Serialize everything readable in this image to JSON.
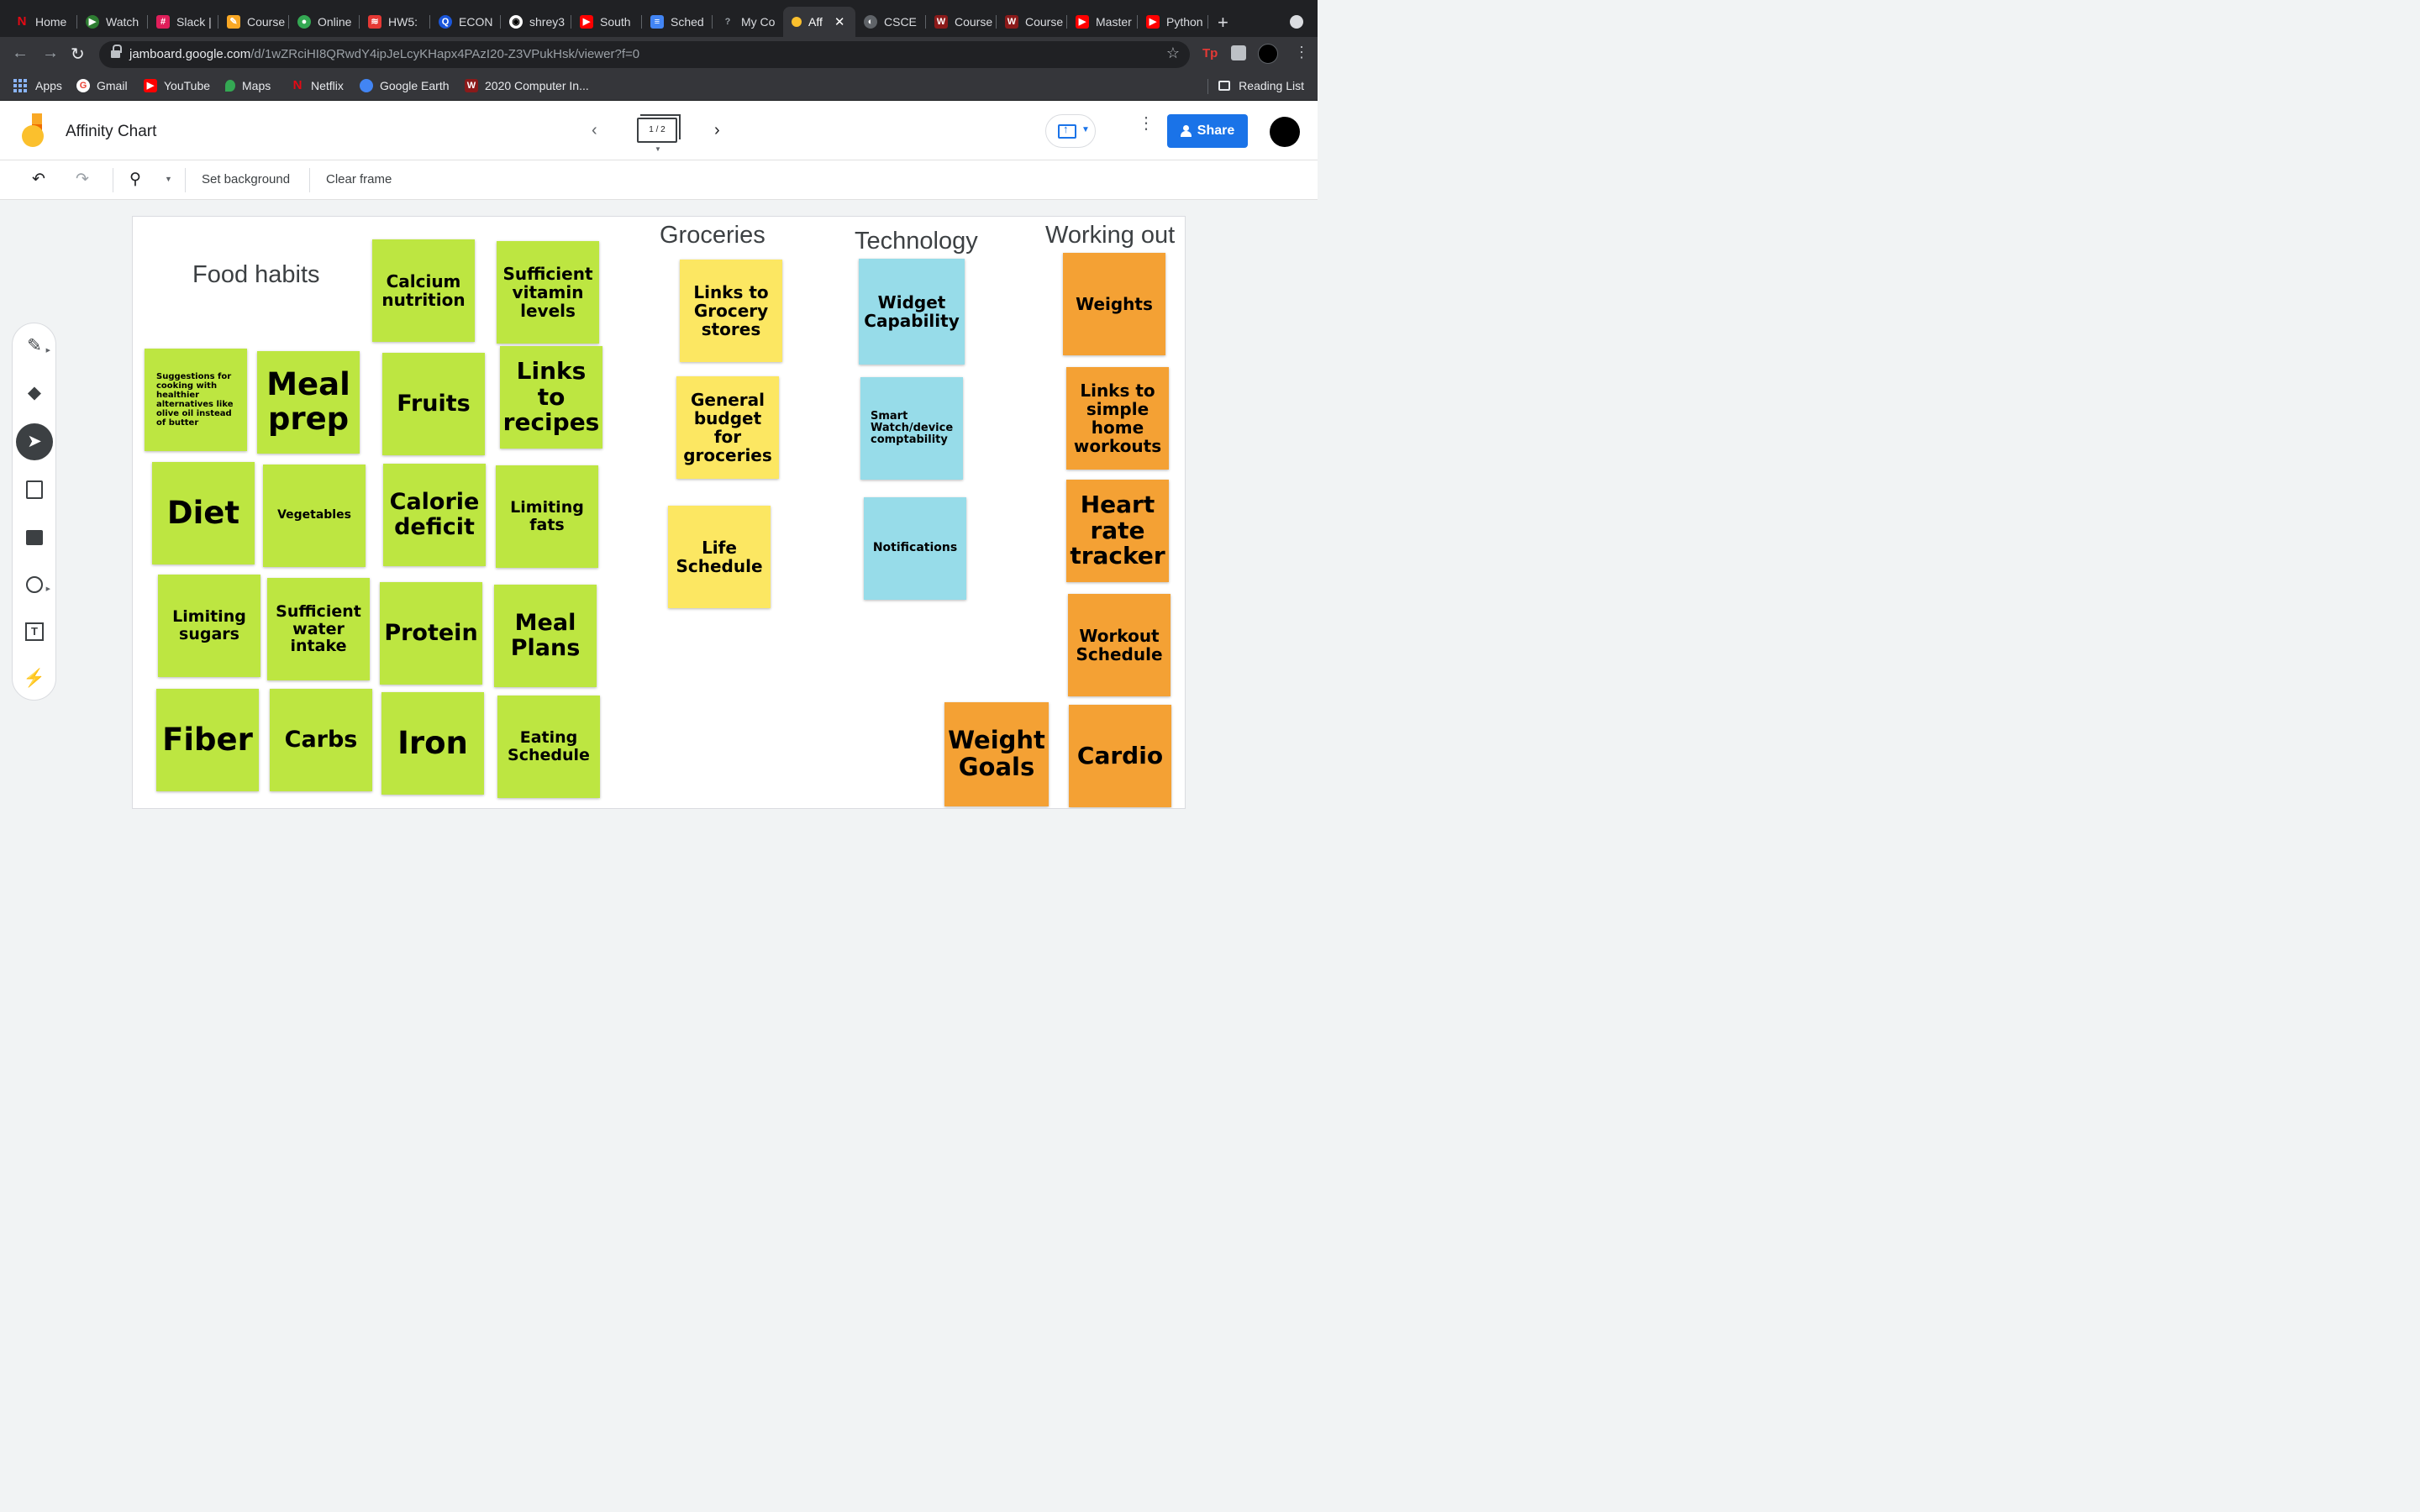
{
  "browser": {
    "tabs": [
      {
        "label": "Home",
        "fav": "N",
        "color": "#e50914"
      },
      {
        "label": "Watch",
        "fav": "▶",
        "color": "#2e7d32"
      },
      {
        "label": "Slack |",
        "fav": "#",
        "color": "#4a154b"
      },
      {
        "label": "Course",
        "fav": "✎",
        "color": "#f9a825"
      },
      {
        "label": "Online",
        "fav": "●",
        "color": "#34a853"
      },
      {
        "label": "HW5:",
        "fav": "≋",
        "color": "#e53935"
      },
      {
        "label": "ECON",
        "fav": "Q",
        "color": "#1a56db"
      },
      {
        "label": "shrey3",
        "fav": "◉",
        "color": "#000000"
      },
      {
        "label": "South",
        "fav": "▶",
        "color": "#ff0000"
      },
      {
        "label": "Sched",
        "fav": "≡",
        "color": "#4285f4"
      },
      {
        "label": "My Co",
        "fav": "?",
        "color": "#5f6368"
      },
      {
        "label": "Aff",
        "fav": "●",
        "color": "#fbc02d",
        "active": true
      },
      {
        "label": "CSCE",
        "fav": "◐",
        "color": "#5f6368"
      },
      {
        "label": "Course",
        "fav": "W",
        "color": "#8b1a1a"
      },
      {
        "label": "Course",
        "fav": "W",
        "color": "#8b1a1a"
      },
      {
        "label": "Master",
        "fav": "▶",
        "color": "#ff0000"
      },
      {
        "label": "Python",
        "fav": "▶",
        "color": "#ff0000"
      }
    ],
    "url_host": "jamboard.google.com",
    "url_path": "/d/1wZRciHI8QRwdY4ipJeLcyKHapx4PAzI20-Z3VPukHsk/viewer?f=0",
    "bookmarks": [
      {
        "label": "Apps",
        "kind": "apps-grid"
      },
      {
        "label": "Gmail",
        "fav": "G",
        "color": "#ea4335"
      },
      {
        "label": "YouTube",
        "fav": "▶",
        "color": "#ff0000"
      },
      {
        "label": "Maps",
        "fav": "⬤",
        "color": "#34a853"
      },
      {
        "label": "Netflix",
        "fav": "N",
        "color": "#e50914"
      },
      {
        "label": "Google Earth",
        "fav": "◉",
        "color": "#4285f4"
      },
      {
        "label": "2020 Computer In...",
        "fav": "W",
        "color": "#8b1a1a"
      }
    ],
    "reading_list": "Reading List",
    "extension_tp": "Tp"
  },
  "jamboard": {
    "title": "Affinity Chart",
    "frame_indicator": "1 / 2",
    "share_label": "Share",
    "toolbar": {
      "set_background": "Set background",
      "clear_frame": "Clear frame"
    },
    "colors": {
      "green": "#bde641",
      "yellow": "#fce762",
      "blue": "#97dce9",
      "orange": "#f4a134",
      "accent": "#1a73e8"
    }
  },
  "board": {
    "headings": {
      "food_habits": "Food habits",
      "groceries": "Groceries",
      "technology": "Technology",
      "working_out": "Working out"
    },
    "notes": {
      "calcium": "Calcium nutrition",
      "vitamins": "Sufficient vitamin levels",
      "suggestions": "Suggestions for cooking with healthier alternatives like olive oil instead of butter",
      "meal_prep": "Meal prep",
      "fruits": "Fruits",
      "recipes": "Links to recipes",
      "diet": "Diet",
      "vegetables": "Vegetables",
      "calorie": "Calorie deficit",
      "fats": "Limiting fats",
      "sugars": "Limiting sugars",
      "water": "Sufficient water intake",
      "protein": "Protein",
      "meal_plans": "Meal Plans",
      "fiber": "Fiber",
      "carbs": "Carbs",
      "iron": "Iron",
      "eating_schedule": "Eating Schedule",
      "grocery_links": "Links to Grocery stores",
      "budget": "General budget for groceries",
      "life_schedule": "Life Schedule",
      "widget": "Widget Capability",
      "smartwatch": "Smart Watch/device comptability",
      "notifications": "Notifications",
      "weights": "Weights",
      "home_workouts": "Links to simple home workouts",
      "heart_rate": "Heart rate tracker",
      "workout_schedule": "Workout Schedule",
      "weight_goals": "Weight Goals",
      "cardio": "Cardio"
    }
  }
}
